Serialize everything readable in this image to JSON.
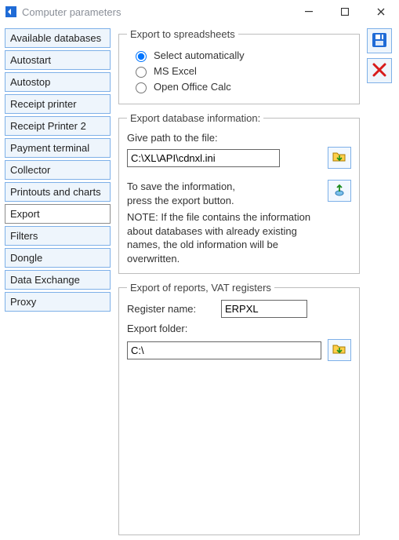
{
  "window": {
    "title": "Computer parameters"
  },
  "sidebar": {
    "items": [
      {
        "label": "Available databases"
      },
      {
        "label": "Autostart"
      },
      {
        "label": "Autostop"
      },
      {
        "label": "Receipt printer"
      },
      {
        "label": "Receipt Printer 2"
      },
      {
        "label": "Payment terminal"
      },
      {
        "label": "Collector"
      },
      {
        "label": "Printouts and charts"
      },
      {
        "label": "Export"
      },
      {
        "label": "Filters"
      },
      {
        "label": "Dongle"
      },
      {
        "label": "Data Exchange"
      },
      {
        "label": "Proxy"
      }
    ],
    "active_index": 8
  },
  "export": {
    "spreadsheets": {
      "legend": "Export to spreadsheets",
      "options": {
        "auto": "Select automatically",
        "excel": "MS Excel",
        "ooo": "Open Office Calc"
      },
      "selected": "auto"
    },
    "dbinfo": {
      "legend": "Export database information:",
      "path_label": "Give path to the file:",
      "path_value": "C:\\XL\\API\\cdnxl.ini",
      "note_line1": "To save the information,",
      "note_line2": "press the export button.",
      "note_line3": "NOTE: If the file contains the information about databases with already existing names, the old information will be overwritten."
    },
    "reports": {
      "legend": "Export of reports, VAT registers",
      "register_label": "Register name:",
      "register_value": "ERPXL",
      "folder_label": "Export folder:",
      "folder_value": "C:\\"
    }
  }
}
